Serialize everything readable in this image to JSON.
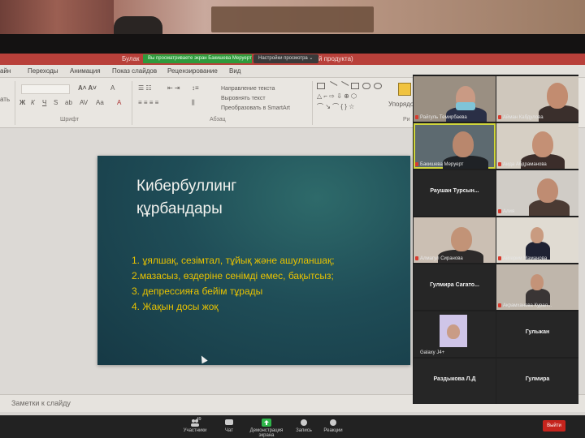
{
  "window": {
    "app_title_fragment": "Булак",
    "share_banner": "Вы просматриваете экран Бакишева Меруерт",
    "share_settings": "Настройки просмотра ⌄",
    "title_suffix": "й продукта)"
  },
  "menu": [
    "айн",
    "Переходы",
    "Анимация",
    "Показ слайдов",
    "Рецензирование",
    "Вид"
  ],
  "ribbon": {
    "font_group_label": "Шрифт",
    "paragraph_group_label": "Абзац",
    "text_direction": "Направление текста",
    "align_text": "Выровнять текст",
    "convert_smartart": "Преобразовать в SmartArt",
    "arrange_label": "Упорядоч",
    "left_fragment": "ать",
    "drawing_fragment": "Ри"
  },
  "slide": {
    "title_line1": "Кибербуллинг",
    "title_line2": "құрбандары",
    "bullets": [
      "1. ұялшақ, сезімтал, тұйық және ашуланшақ;",
      "2.мазасыз, өздеріне сенімді емес, бақытсыз;",
      "3. депрессияға бейім тұрады",
      "4. Жақын досы жоқ"
    ]
  },
  "notes_placeholder": "Заметки к слайду",
  "participants": [
    {
      "name": "Райгуль Темирбаева",
      "video": true
    },
    {
      "name": "Айман Кабдулова",
      "video": true
    },
    {
      "name": "Бакишева Меруерт",
      "video": true,
      "active": true
    },
    {
      "name": "Аида Абдраманова",
      "video": true
    },
    {
      "name": "Раушан Турсын...",
      "video": false
    },
    {
      "name": "Алия",
      "video": true
    },
    {
      "name": "Алмагул Сиранова",
      "video": true
    },
    {
      "name": "Айгерим Маманова",
      "video": true
    },
    {
      "name": "Гулмира Сагато...",
      "video": false
    },
    {
      "name": "Акрамханова Курал...",
      "video": true
    },
    {
      "name": "Galaxy J4+",
      "video": true
    },
    {
      "name": "Гульжан",
      "video": false
    },
    {
      "name": "Раздыкова Л.Д",
      "video": false
    },
    {
      "name": "Гулмира",
      "video": false
    }
  ],
  "zoom_toolbar": {
    "participants_label": "Участники",
    "participants_count": "49",
    "chat_label": "Чат",
    "share_label": "Демонстрация экрана",
    "record_label": "Запись",
    "reactions_label": "Реакции",
    "end_label": "Выйти"
  },
  "colors": {
    "title_strip": "#b8403a",
    "share_banner": "#2e9a3c",
    "slide_text": "#e8c200",
    "end_button": "#c5241d"
  }
}
